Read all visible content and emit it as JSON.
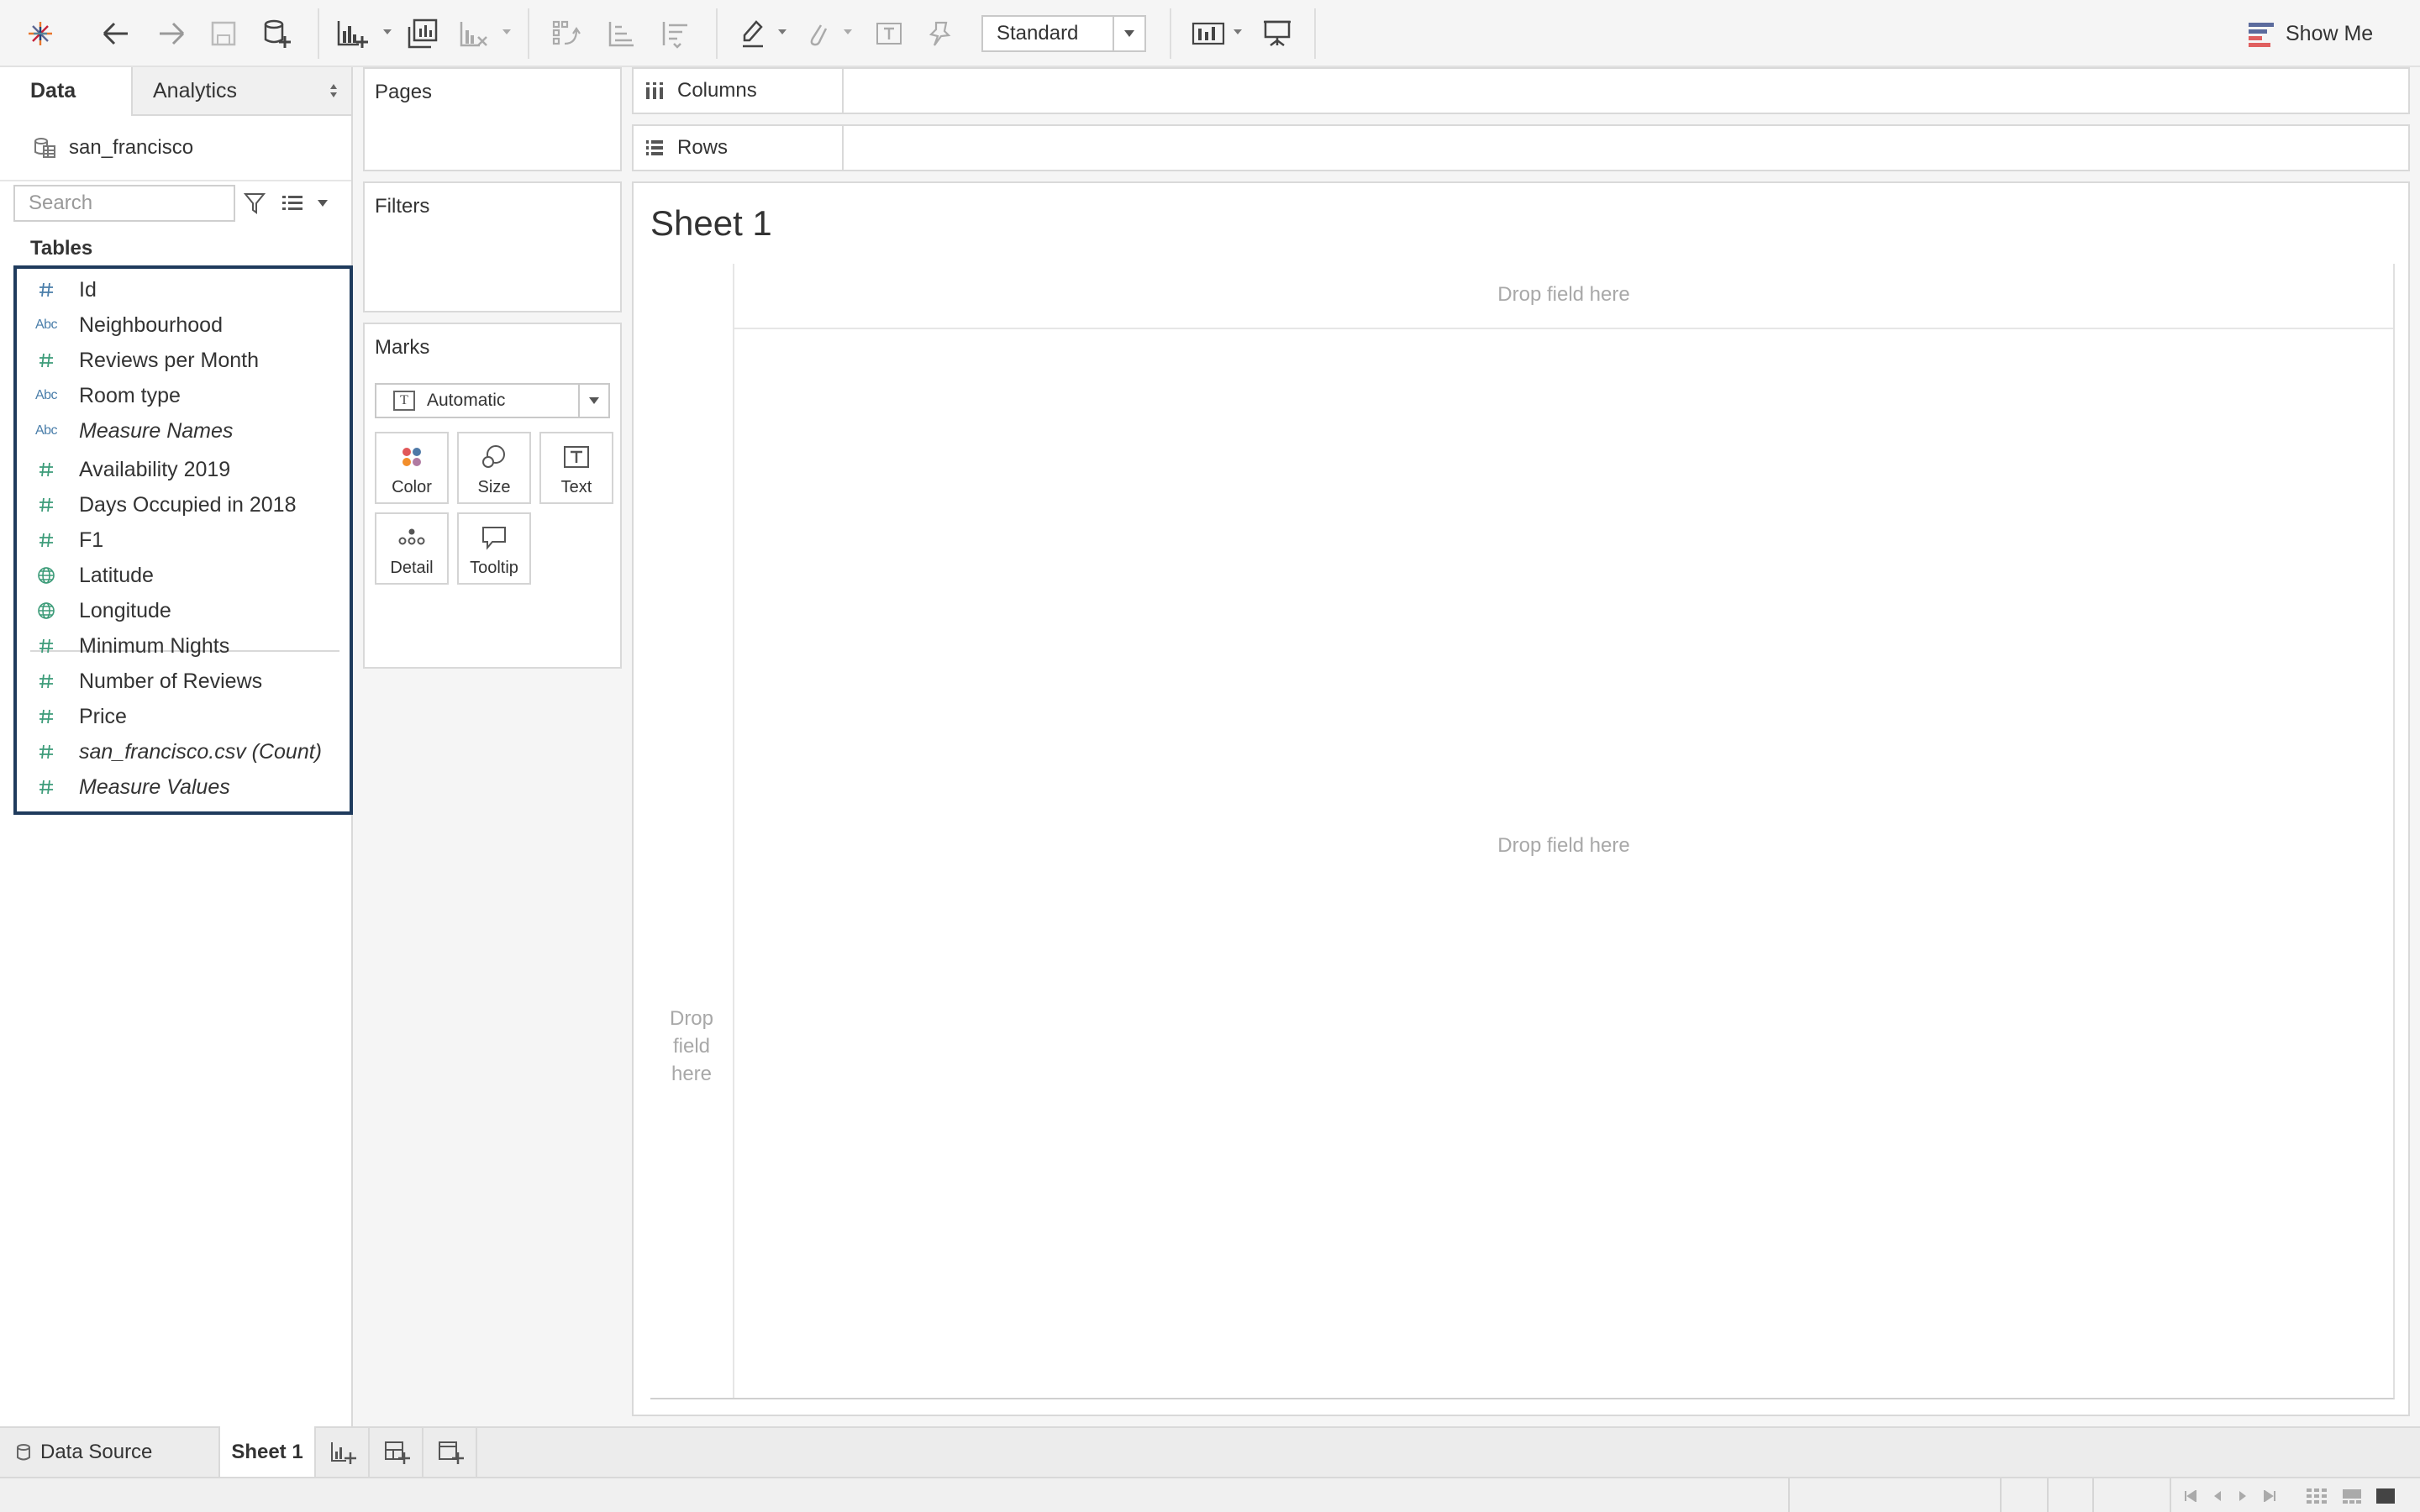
{
  "toolbar": {
    "fit_value": "Standard",
    "show_me_label": "Show Me",
    "icons": [
      "tableau-logo-icon",
      "undo-icon",
      "redo-icon",
      "save-icon",
      "new-data-source-icon",
      "new-worksheet-icon",
      "duplicate-sheet-icon",
      "clear-sheet-icon",
      "swap-icon",
      "sort-ascending-icon",
      "sort-descending-icon",
      "highlight-icon",
      "group-icon",
      "labels-icon",
      "fix-axes-icon",
      "cards-icon",
      "presentation-icon",
      "show-me-icon"
    ]
  },
  "data_pane": {
    "tab_data": "Data",
    "tab_analytics": "Analytics",
    "datasource_name": "san_francisco",
    "search_placeholder": "Search",
    "tables_label": "Tables",
    "fields": [
      {
        "name": "Id",
        "type": "number",
        "italic": false
      },
      {
        "name": "Neighbourhood",
        "type": "string",
        "italic": false
      },
      {
        "name": "Reviews per Month",
        "type": "number",
        "italic": false
      },
      {
        "name": "Room type",
        "type": "string",
        "italic": false
      },
      {
        "name": "Measure Names",
        "type": "string",
        "italic": true
      },
      {
        "name": "Availability 2019",
        "type": "number",
        "italic": false
      },
      {
        "name": "Days Occupied in 2018",
        "type": "number",
        "italic": false
      },
      {
        "name": "F1",
        "type": "number",
        "italic": false
      },
      {
        "name": "Latitude",
        "type": "geo",
        "italic": false
      },
      {
        "name": "Longitude",
        "type": "geo",
        "italic": false
      },
      {
        "name": "Minimum Nights",
        "type": "number",
        "italic": false
      },
      {
        "name": "Number of Reviews",
        "type": "number",
        "italic": false
      },
      {
        "name": "Price",
        "type": "number",
        "italic": false
      },
      {
        "name": "san_francisco.csv (Count)",
        "type": "number",
        "italic": true
      },
      {
        "name": "Measure Values",
        "type": "number",
        "italic": true
      }
    ],
    "type_label_string": "Abc"
  },
  "shelves": {
    "pages": "Pages",
    "filters": "Filters",
    "marks": "Marks",
    "mark_type": "Automatic",
    "columns": "Columns",
    "rows": "Rows",
    "mark_buttons": {
      "color": "Color",
      "size": "Size",
      "text": "Text",
      "detail": "Detail",
      "tooltip": "Tooltip"
    }
  },
  "view": {
    "sheet_title": "Sheet 1",
    "drop_columns": "Drop field here",
    "drop_body": "Drop field here",
    "drop_rows": "Drop field here"
  },
  "sheet_tabs": {
    "data_source": "Data Source",
    "sheet1": "Sheet 1"
  },
  "colors": {
    "accent_blue": "#4a7eaa",
    "field_green": "#3d9c79",
    "selection_border": "#1f3b5d"
  }
}
